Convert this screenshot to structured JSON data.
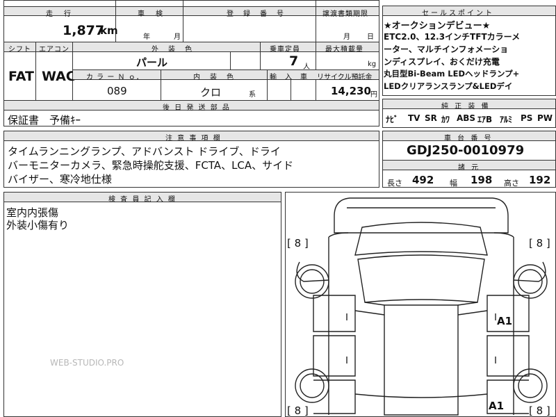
{
  "top_row": {
    "mileage_header": "走　行",
    "shaken_header": "車　検",
    "registration_header": "登　録　番　号",
    "transfer_header": "譲渡書類期限",
    "mileage_value": "1,877",
    "mileage_unit": "km",
    "shaken_year": "年",
    "shaken_month": "月",
    "transfer_month": "月",
    "transfer_day": "日"
  },
  "spec_row": {
    "shift_header": "シフト",
    "ac_header": "エアコン",
    "color_header": "外　装　色",
    "capacity_header": "乗車定員",
    "max_load_header": "最大積載量",
    "shift_value": "FAT",
    "ac_value": "WAC",
    "color_value": "パール",
    "capacity_value": "7",
    "capacity_unit": "人",
    "max_load_unit": "kg",
    "color_no_header": "カ ラ ー Ｎ ｏ．",
    "interior_header": "内　装　色",
    "import_header": "輸　入　車",
    "recycle_header": "リサイクル預託金",
    "color_no_value": "089",
    "interior_value": "クロ",
    "interior_suffix": "系",
    "recycle_value": "14,230",
    "recycle_unit": "円"
  },
  "later_parts": {
    "header": "後 日 発 送 部 品",
    "value": "保証書　予備ｷｰ"
  },
  "notes": {
    "header": "注 意 事 項 欄",
    "lines": [
      "タイムランニングランプ、アドバンスト ドライブ、ドライ",
      "バーモニターカメラ、緊急時操舵支援、FCTA、LCA、サイド",
      "バイザー、寒冷地仕様"
    ]
  },
  "inspector": {
    "header": "検 査 員 記 入 欄",
    "lines": [
      "室内内張傷",
      "外装小傷有り"
    ]
  },
  "sales_points": {
    "header": "セールスポイント",
    "lines": [
      "★オークションデビュー★",
      "ETC2.0、12.3インチTFTカラーメ",
      "ーター、マルチインフォメーショ",
      "ンディスプレイ、おくだけ充電",
      "丸目型Bi-Beam LEDヘッドランプ+",
      "LEDクリアランスランプ&LEDデイ"
    ]
  },
  "equipment": {
    "header": "純 正 装 備",
    "items": [
      "ﾅﾋﾞ",
      "TV",
      "SR",
      "ｶﾜ",
      "ABS",
      "ｴｱB",
      "ｱﾙﾐ",
      "PS",
      "PW"
    ]
  },
  "chassis": {
    "header": "車 台 番 号",
    "value": "GDJ250-0010979"
  },
  "dimensions": {
    "header": "諸 元",
    "length_label": "長さ",
    "length_value": "492",
    "width_label": "幅",
    "width_value": "198",
    "height_label": "高さ",
    "height_value": "192"
  },
  "diagram": {
    "tire_front_left": "[ 8 ]",
    "tire_front_right": "[ 8 ]",
    "tire_rear_left": "[ 8 ]",
    "tire_rear_right": "[ 8 ]",
    "mark_right_door": "A1",
    "mark_rear": "A1"
  },
  "watermark": "WEB-STUDIO.PRO"
}
